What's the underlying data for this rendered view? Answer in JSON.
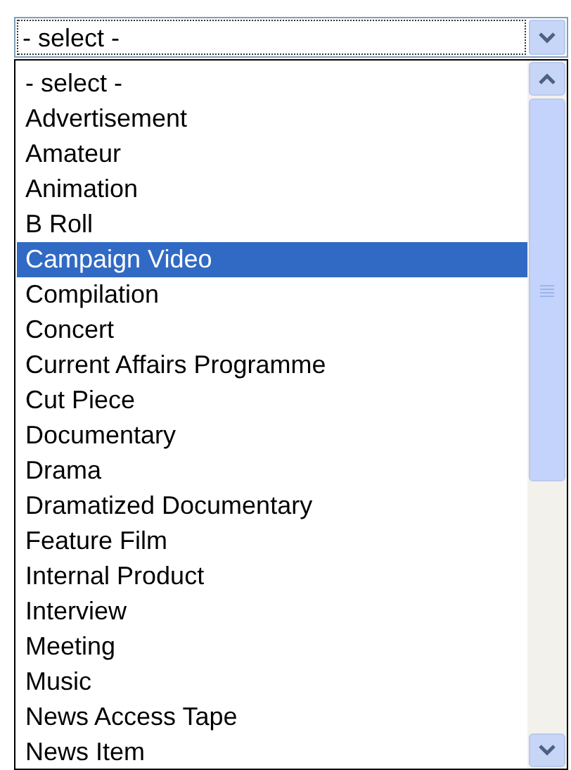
{
  "select": {
    "value": "- select -"
  },
  "options": [
    {
      "label": "- select -",
      "selected": false
    },
    {
      "label": "Advertisement",
      "selected": false
    },
    {
      "label": "Amateur",
      "selected": false
    },
    {
      "label": "Animation",
      "selected": false
    },
    {
      "label": "B Roll",
      "selected": false
    },
    {
      "label": "Campaign Video",
      "selected": true
    },
    {
      "label": "Compilation",
      "selected": false
    },
    {
      "label": "Concert",
      "selected": false
    },
    {
      "label": "Current Affairs Programme",
      "selected": false
    },
    {
      "label": "Cut Piece",
      "selected": false
    },
    {
      "label": "Documentary",
      "selected": false
    },
    {
      "label": "Drama",
      "selected": false
    },
    {
      "label": "Dramatized Documentary",
      "selected": false
    },
    {
      "label": "Feature Film",
      "selected": false
    },
    {
      "label": "Internal Product",
      "selected": false
    },
    {
      "label": "Interview",
      "selected": false
    },
    {
      "label": "Meeting",
      "selected": false
    },
    {
      "label": "Music",
      "selected": false
    },
    {
      "label": "News Access Tape",
      "selected": false
    },
    {
      "label": "News Item",
      "selected": false
    }
  ]
}
